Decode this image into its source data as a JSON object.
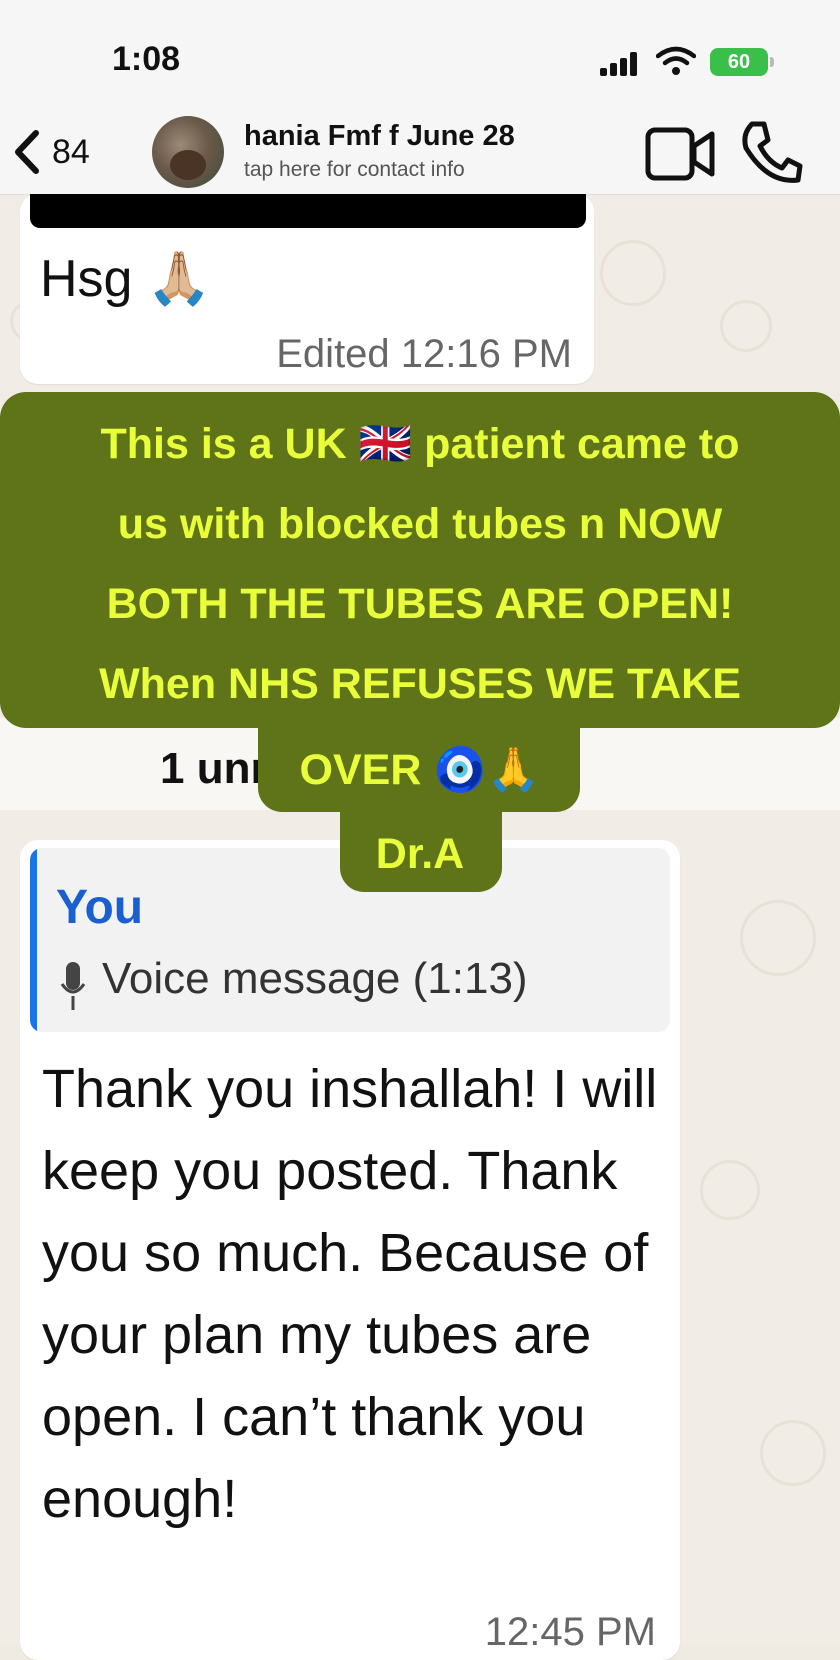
{
  "status_bar": {
    "time": "1:08",
    "battery": "60"
  },
  "header": {
    "back_count": "84",
    "contact_name": "hania Fmf f June 28",
    "contact_subtitle": "tap here for contact info"
  },
  "messages": {
    "first": {
      "text": "Hsg 🙏🏼",
      "meta": "Edited 12:16 PM"
    },
    "unread_banner": "1 unread message",
    "second": {
      "quote_author": "You",
      "quote_text": "Voice message (1:13)",
      "text": "Thank you inshallah! I will keep you posted. Thank you so much. Because of your plan my tubes are open. I can’t thank you enough!",
      "time": "12:45 PM"
    }
  },
  "overlay": {
    "lines": [
      "This is a UK 🇬🇧 patient came to",
      "us with blocked tubes n NOW",
      "BOTH THE TUBES ARE OPEN!",
      "When NHS REFUSES WE TAKE",
      "OVER 🧿🙏",
      "Dr.A"
    ]
  },
  "colors": {
    "overlay_bg": "#5f7418",
    "overlay_text": "#e8ff3a",
    "quote_accent": "#1a73e8"
  }
}
